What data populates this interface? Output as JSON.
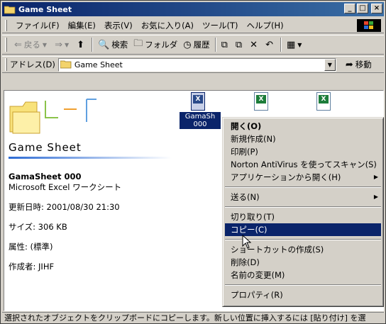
{
  "window": {
    "title": "Game Sheet"
  },
  "title_buttons": {
    "minimize": "_",
    "maximize": "□",
    "close": "×"
  },
  "menubar": {
    "items": [
      "ファイル(F)",
      "編集(E)",
      "表示(V)",
      "お気に入り(A)",
      "ツール(T)",
      "ヘルプ(H)"
    ]
  },
  "toolbar": {
    "back": "戻る",
    "search": "検索",
    "folders": "フォルダ",
    "history": "履歴"
  },
  "address": {
    "label": "アドレス(D)",
    "value": "Game Sheet",
    "go": "移動"
  },
  "left_panel": {
    "title": "Game Sheet",
    "file_name": "GamaSheet 000",
    "file_type": "Microsoft Excel ワークシート",
    "modified": "更新日時: 2001/08/30 21:30",
    "size": "サイズ: 306 KB",
    "attributes": "属性: (標準)",
    "author": "作成者: JIHF"
  },
  "files": {
    "selected_label_1": "GamaSh",
    "selected_label_2": "000"
  },
  "context_menu": {
    "items": [
      {
        "label": "開く(O)",
        "bold": true
      },
      {
        "label": "新規作成(N)"
      },
      {
        "label": "印刷(P)"
      },
      {
        "label": "Norton AntiVirus を使ってスキャン(S)"
      },
      {
        "label": "アプリケーションから開く(H)",
        "submenu": true
      },
      {
        "separator": true
      },
      {
        "label": "送る(N)",
        "submenu": true
      },
      {
        "separator": true
      },
      {
        "label": "切り取り(T)"
      },
      {
        "label": "コピー(C)",
        "highlighted": true
      },
      {
        "separator": true
      },
      {
        "label": "ショートカットの作成(S)"
      },
      {
        "label": "削除(D)"
      },
      {
        "label": "名前の変更(M)"
      },
      {
        "separator": true
      },
      {
        "label": "プロパティ(R)"
      }
    ]
  },
  "statusbar": {
    "text": "選択されたオブジェクトをクリップボードにコピーします。新しい位置に挿入するには [貼り付け] を選"
  },
  "colors": {
    "selection": "#0a246a",
    "titlebar_start": "#0a246a",
    "excel_green": "#1d7d3a"
  }
}
